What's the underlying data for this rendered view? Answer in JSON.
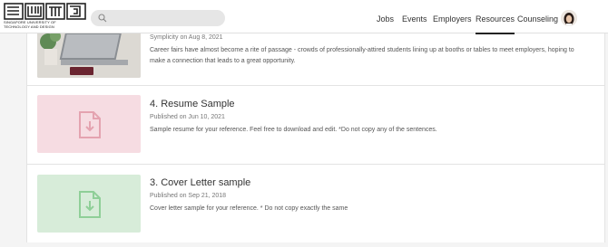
{
  "header": {
    "logo_lines": [
      "SINGAPORE UNIVERSITY OF",
      "TECHNOLOGY AND DESIGN"
    ],
    "search": {
      "placeholder": ""
    },
    "nav": [
      {
        "label": "Jobs",
        "active": false
      },
      {
        "label": "Events",
        "active": false
      },
      {
        "label": "Employers",
        "active": false
      },
      {
        "label": "Resources",
        "active": true
      },
      {
        "label": "Counseling",
        "active": false
      }
    ]
  },
  "articles": [
    {
      "title": "",
      "date": "Symplicity on Aug 8, 2021",
      "description": "Career fairs have almost become a rite of passage - crowds of professionally-attired students lining up at booths or tables to meet employers, hoping to make a connection that leads to a great opportunity.",
      "thumbnail": "laptop-photo"
    },
    {
      "title": "4. Resume Sample",
      "date": "Published on Jun 10, 2021",
      "description": "Sample resume for your reference. Feel free to download and edit. *Do not copy any of the sentences.",
      "thumbnail": "download-document-icon",
      "thumb_color": "#f6dce2",
      "icon_color": "#e4a3b0"
    },
    {
      "title": "3. Cover Letter sample",
      "date": "Published on Sep 21, 2018",
      "description": "Cover letter sample for your reference. * Do not copy exactly the same",
      "thumbnail": "download-document-icon",
      "thumb_color": "#d7ecd9",
      "icon_color": "#8fcf98"
    }
  ]
}
